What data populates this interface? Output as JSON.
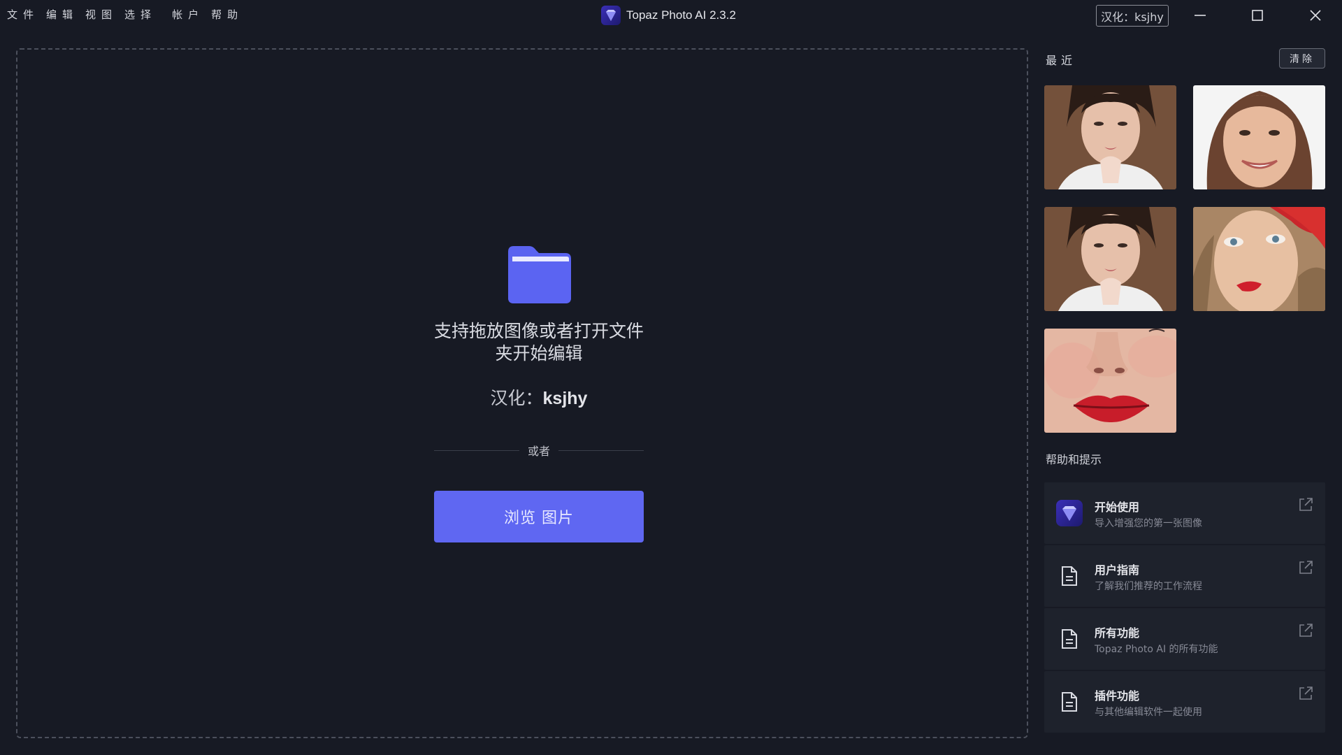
{
  "menu": {
    "items": [
      "文件",
      "编辑",
      "视图",
      "选择",
      "帐户",
      "帮助"
    ]
  },
  "titlebar": {
    "app_title": "Topaz Photo AI 2.3.2",
    "tag": "汉化：ksjhy"
  },
  "dropzone": {
    "message": "支持拖放图像或者打开文件夹开始编辑",
    "credit_prefix": "汉化：",
    "credit_name": "ksjhy",
    "or_label": "或者",
    "browse_label": "浏览 图片"
  },
  "recent": {
    "title": "最近",
    "clear_label": "清除",
    "thumbnails": [
      "portrait-woman-1",
      "portrait-woman-smile",
      "portrait-woman-1",
      "portrait-woman-red-hat",
      "closeup-lips-nose"
    ]
  },
  "help": {
    "title": "帮助和提示",
    "items": [
      {
        "title": "开始使用",
        "subtitle": "导入增强您的第一张图像",
        "icon": "topaz-logo-icon"
      },
      {
        "title": "用户指南",
        "subtitle": "了解我们推荐的工作流程",
        "icon": "document-icon"
      },
      {
        "title": "所有功能",
        "subtitle": "Topaz Photo AI 的所有功能",
        "icon": "document-icon"
      },
      {
        "title": "插件功能",
        "subtitle": "与其他编辑软件一起使用",
        "icon": "document-icon"
      }
    ]
  },
  "colors": {
    "background": "#171a24",
    "accent": "#5f67f2",
    "folder": "#5a63f0",
    "card": "#1e222c"
  }
}
